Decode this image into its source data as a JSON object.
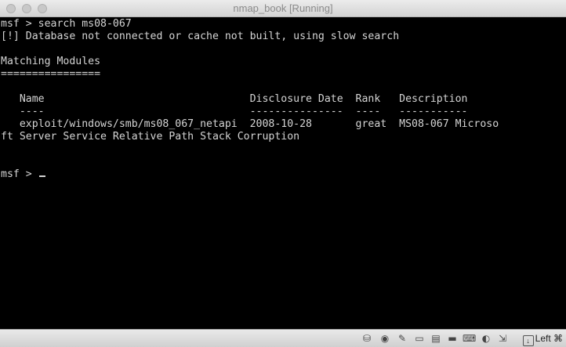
{
  "window": {
    "title": "nmap_book [Running]"
  },
  "terminal": {
    "lines": [
      "msf > search ms08-067",
      "[!] Database not connected or cache not built, using slow search",
      "",
      "Matching Modules",
      "================",
      "",
      "   Name                                 Disclosure Date  Rank   Description",
      "   ----                                 ---------------  ----   -----------",
      "   exploit/windows/smb/ms08_067_netapi  2008-10-28       great  MS08-067 Microso",
      "ft Server Service Relative Path Stack Corruption",
      "",
      "",
      "msf > "
    ]
  },
  "statusbar": {
    "icons": [
      "hard-disk-icon",
      "optical-drive-icon",
      "usb-icon",
      "shared-folder-icon",
      "display-icon",
      "network-icon",
      "keyboard-icon",
      "capture-icon",
      "mouse-icon",
      "recording-icon"
    ],
    "host_key_label": "Left ⌘"
  }
}
